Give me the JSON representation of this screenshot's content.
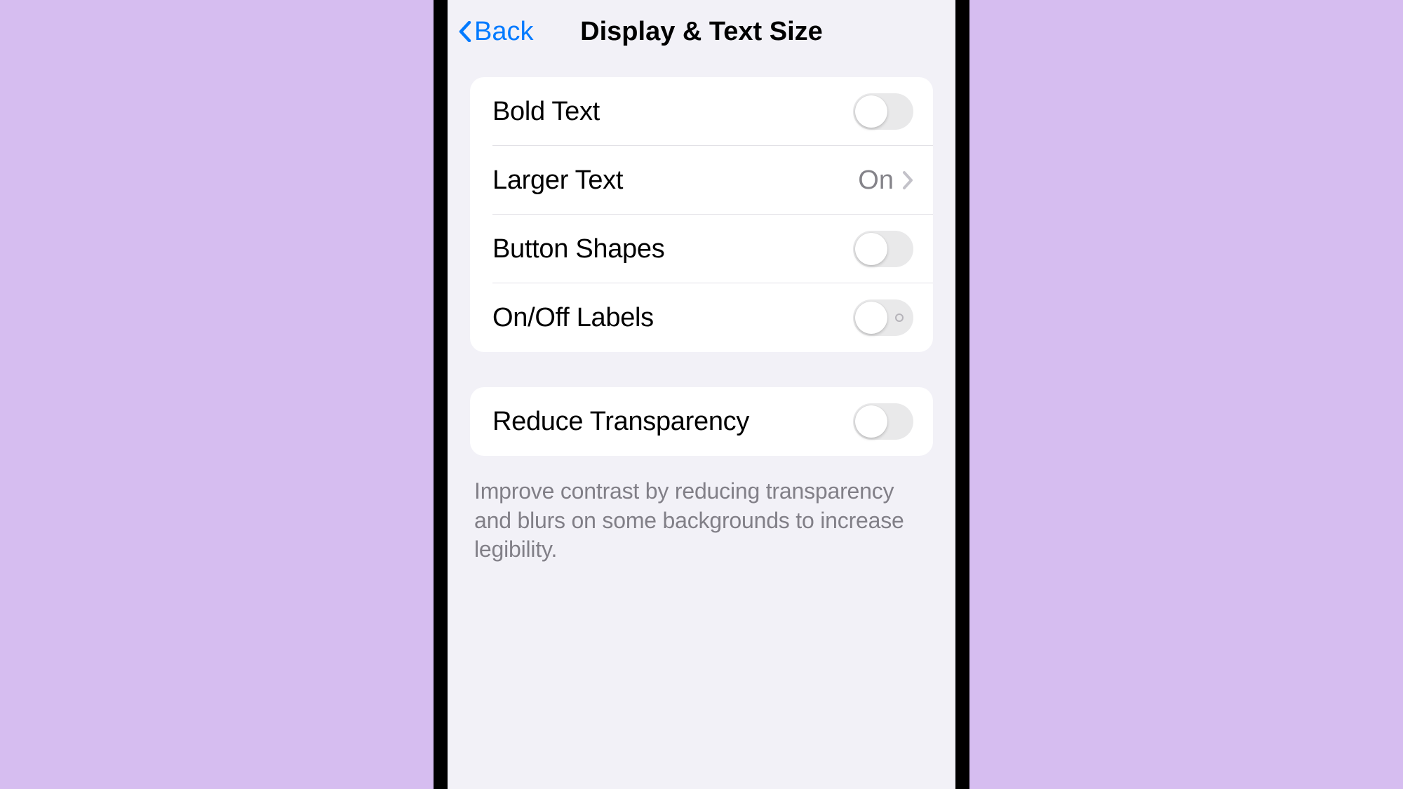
{
  "nav": {
    "back_label": "Back",
    "title": "Display & Text Size"
  },
  "group1": {
    "rows": [
      {
        "label": "Bold Text",
        "type": "toggle",
        "on": false,
        "show_off_label": false
      },
      {
        "label": "Larger Text",
        "type": "link",
        "value": "On"
      },
      {
        "label": "Button Shapes",
        "type": "toggle",
        "on": false,
        "show_off_label": false
      },
      {
        "label": "On/Off Labels",
        "type": "toggle",
        "on": false,
        "show_off_label": true
      }
    ]
  },
  "group2": {
    "rows": [
      {
        "label": "Reduce Transparency",
        "type": "toggle",
        "on": false,
        "show_off_label": false
      }
    ],
    "footer": "Improve contrast by reducing transparency and blurs on some backgrounds to increase legibility."
  }
}
